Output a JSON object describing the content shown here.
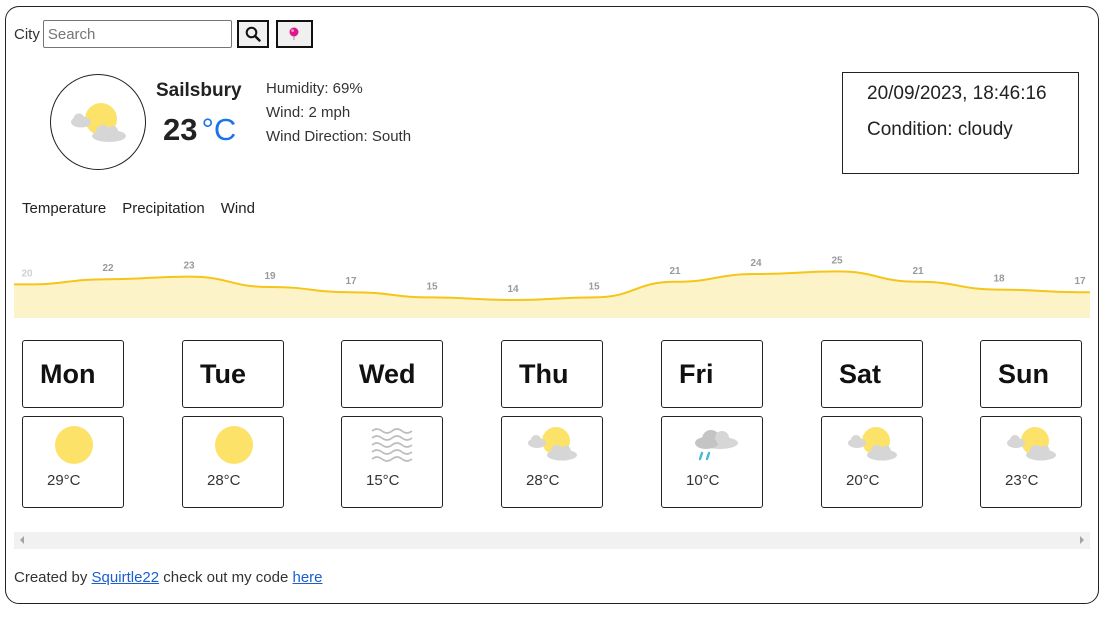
{
  "search": {
    "label": "City",
    "placeholder": "Search",
    "value": ""
  },
  "buttons": {
    "search_icon": "magnifier-icon",
    "location_icon": "location-pin-icon"
  },
  "current": {
    "icon": "partly-cloudy-icon",
    "city": "Sailsbury",
    "temperature": "23",
    "unit": "°C",
    "humidity": "Humidity: 69%",
    "wind": "Wind: 2 mph",
    "wind_direction": "Wind Direction: South"
  },
  "datetime": {
    "datetime": "20/09/2023, 18:46:16",
    "condition": "Condition: cloudy"
  },
  "tabs": [
    {
      "label": "Temperature"
    },
    {
      "label": "Precipitation"
    },
    {
      "label": "Wind"
    }
  ],
  "chart_data": {
    "type": "area",
    "values": [
      20,
      22,
      23,
      19,
      17,
      15,
      14,
      15,
      21,
      24,
      25,
      21,
      18,
      17
    ],
    "data_labels": [
      "20",
      "22",
      "23",
      "19",
      "17",
      "15",
      "14",
      "15",
      "21",
      "24",
      "25",
      "21",
      "18",
      "17"
    ],
    "line_color": "#f5c518",
    "fill_color": "#fdf3c8",
    "grid": false
  },
  "forecast": [
    {
      "day": "Mon",
      "temp": "29°C",
      "icon": "sun-icon"
    },
    {
      "day": "Tue",
      "temp": "28°C",
      "icon": "sun-icon"
    },
    {
      "day": "Wed",
      "temp": "15°C",
      "icon": "fog-icon"
    },
    {
      "day": "Thu",
      "temp": "28°C",
      "icon": "partly-cloudy-icon"
    },
    {
      "day": "Fri",
      "temp": "10°C",
      "icon": "rain-cloud-icon"
    },
    {
      "day": "Sat",
      "temp": "20°C",
      "icon": "partly-cloudy-icon"
    },
    {
      "day": "Sun",
      "temp": "23°C",
      "icon": "partly-cloudy-icon"
    }
  ],
  "footer": {
    "prefix": "Created by ",
    "author": "Squirtle22",
    "middle": " check out my code ",
    "link": "here"
  },
  "colors": {
    "accent_blue": "#1a73e8",
    "sun": "#fde26a",
    "cloud": "#d6d6d6",
    "pin": "#e0178a"
  }
}
